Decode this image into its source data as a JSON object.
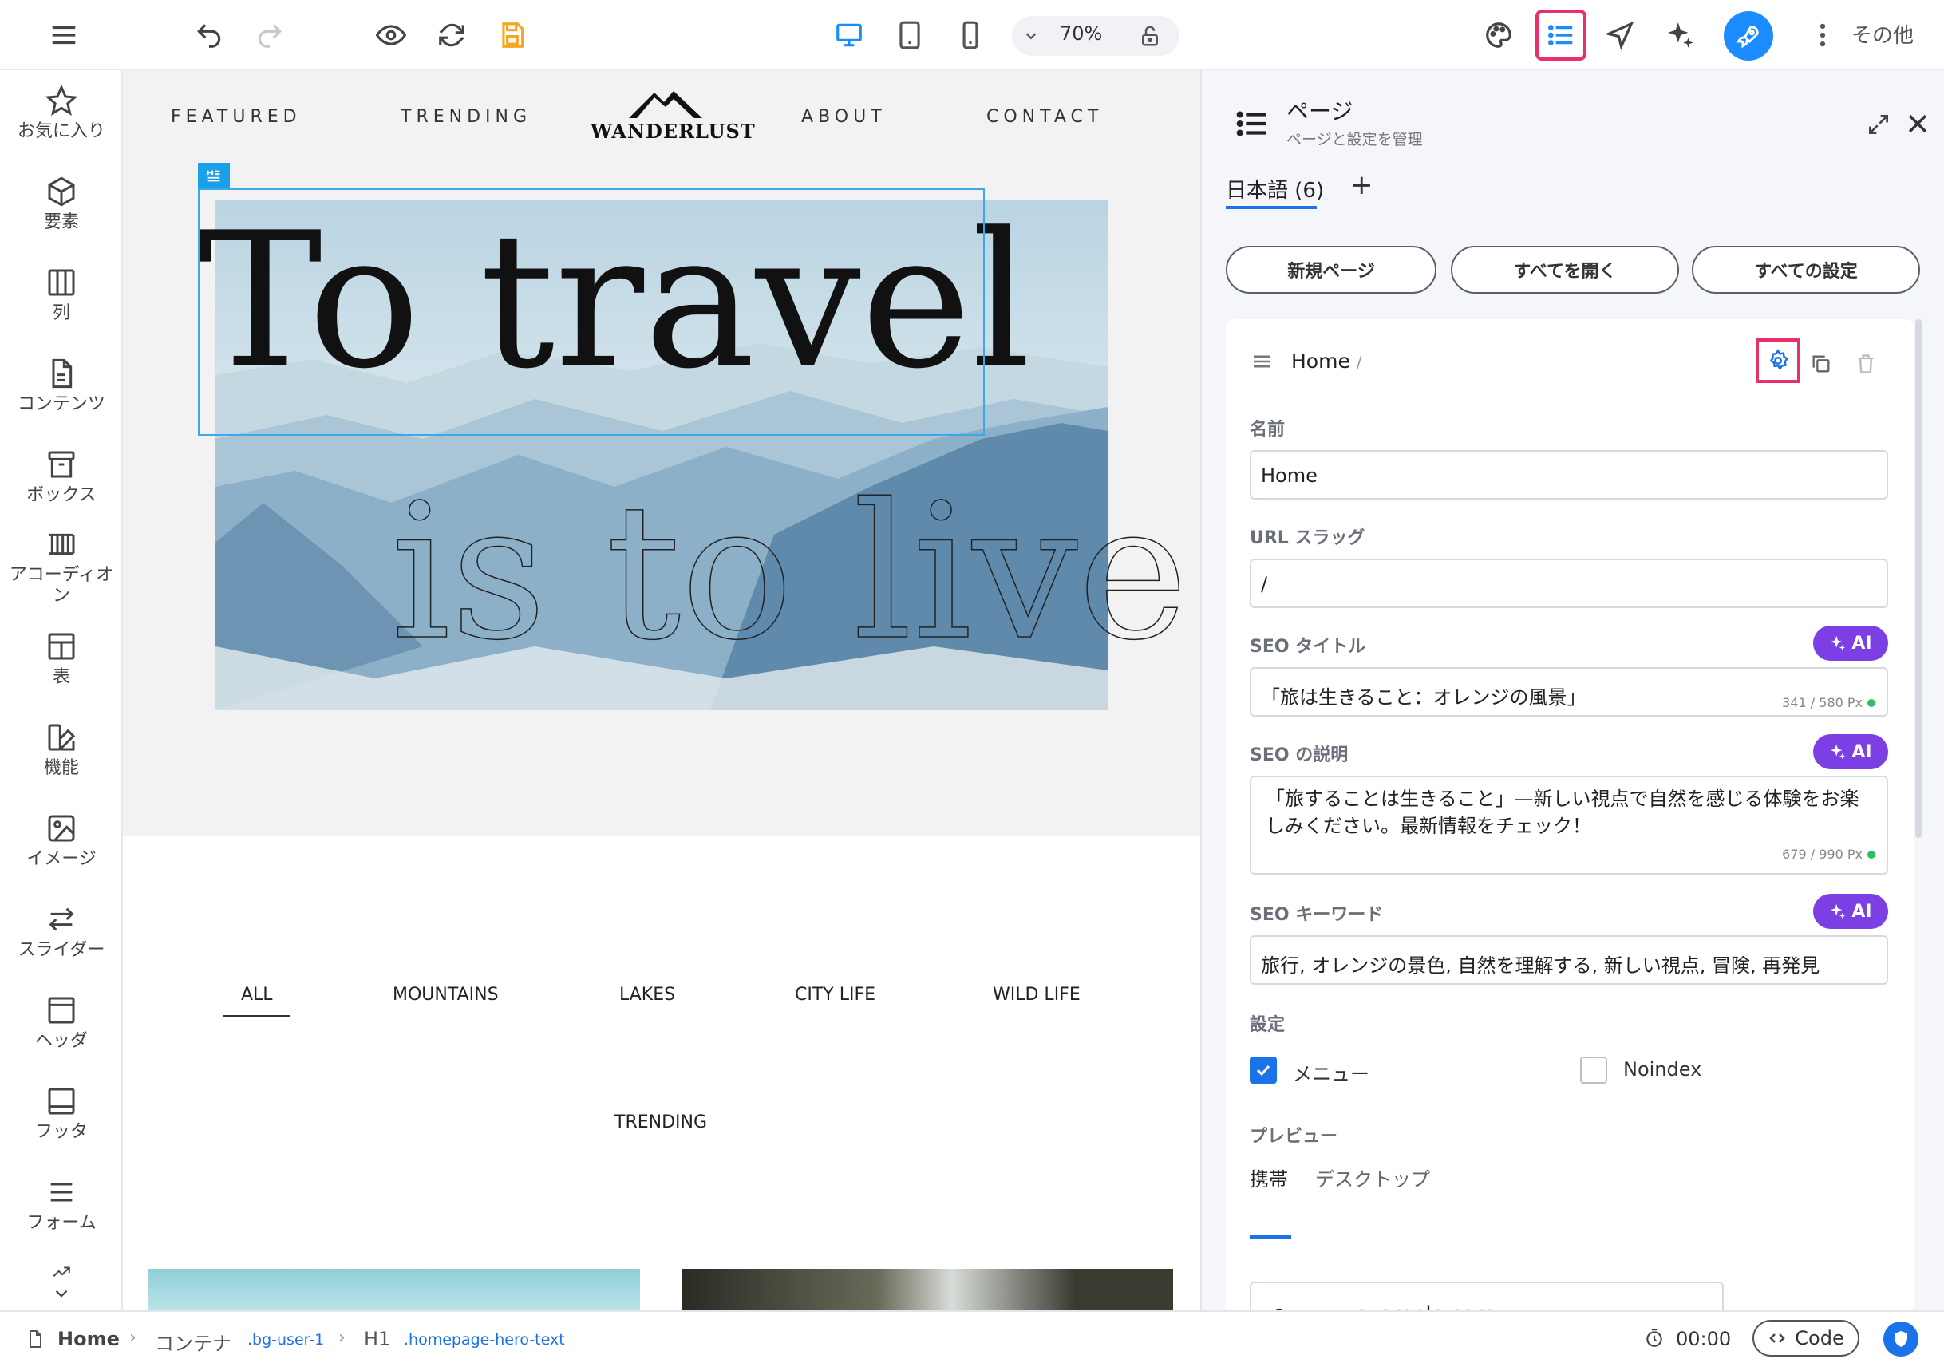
{
  "toolbar": {
    "zoom": "70%",
    "more_label": "その他"
  },
  "sidebar": {
    "items": [
      {
        "label": "お気に入り"
      },
      {
        "label": "要素"
      },
      {
        "label": "列"
      },
      {
        "label": "コンテンツ"
      },
      {
        "label": "ボックス"
      },
      {
        "label": "アコーディオン"
      },
      {
        "label": "表"
      },
      {
        "label": "機能"
      },
      {
        "label": "イメージ"
      },
      {
        "label": "スライダー"
      },
      {
        "label": "ヘッダ"
      },
      {
        "label": "フッタ"
      },
      {
        "label": "フォーム"
      }
    ]
  },
  "canvas": {
    "nav": [
      "FEATURED",
      "TRENDING",
      "ABOUT",
      "CONTACT"
    ],
    "logo_text": "WANDERLUST",
    "hero_title": "To travel",
    "hero_subtitle": "is to live",
    "filters": [
      "ALL",
      "MOUNTAINS",
      "LAKES",
      "CITY LIFE",
      "WILD LIFE"
    ],
    "trending_label": "TRENDING"
  },
  "panel": {
    "title": "ページ",
    "subtitle": "ページと設定を管理",
    "language_tab": "日本語 (6)",
    "add_tab": "+",
    "buttons": {
      "new_page": "新規ページ",
      "expand_all": "すべてを開く",
      "all_settings": "すべての設定"
    },
    "page": {
      "name": "Home",
      "slash": "/",
      "name_label": "名前",
      "name_value": "Home",
      "slug_label": "URL スラッグ",
      "slug_value": "/",
      "seo_title_label": "SEO タイトル",
      "seo_title_value": "「旅は生きること：オレンジの風景」",
      "seo_title_count": "341 / 580 Px",
      "seo_desc_label": "SEO の説明",
      "seo_desc_value": "「旅することは生きること」—新しい視点で自然を感じる体験をお楽しみください。最新情報をチェック！",
      "seo_desc_count": "679 / 990 Px",
      "seo_kw_label": "SEO キーワード",
      "seo_kw_value": "旅行, オレンジの景色, 自然を理解する, 新しい視点, 冒険, 再発見",
      "ai_label": "AI",
      "settings_label": "設定",
      "menu_label": "メニュー",
      "menu_checked": true,
      "noindex_label": "Noindex",
      "noindex_checked": false,
      "preview_label": "プレビュー",
      "preview_tabs": [
        "携帯",
        "デスクトップ"
      ],
      "preview_url": "www.example.com"
    }
  },
  "status": {
    "crumbs": [
      "Home",
      "コンテナ",
      ".bg-user-1",
      "H1",
      ".homepage-hero-text"
    ],
    "timer": "00:00",
    "code_label": "Code"
  },
  "colors": {
    "accent": "#1a73e8",
    "highlight": "#e8306a",
    "ai": "#7b3fe4",
    "save": "#f5a623"
  }
}
